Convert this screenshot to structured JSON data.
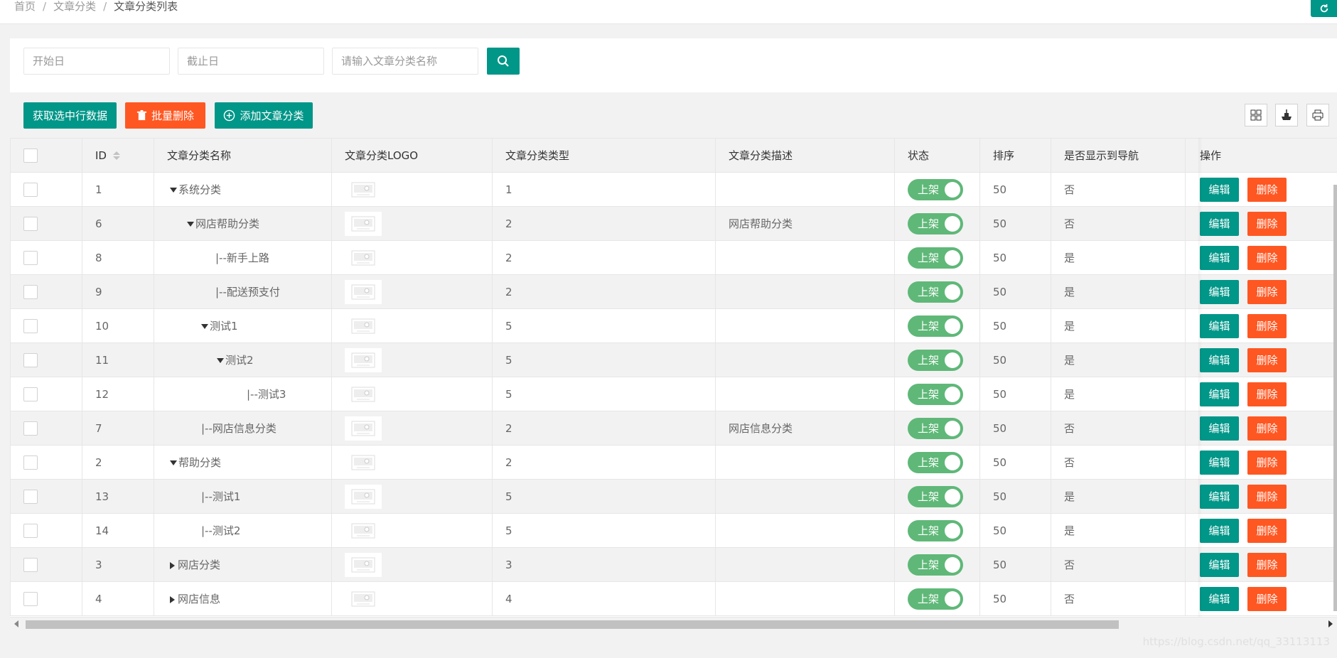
{
  "breadcrumb": [
    "首页",
    "文章分类",
    "文章分类列表"
  ],
  "search": {
    "start_placeholder": "开始日",
    "end_placeholder": "截止日",
    "name_placeholder": "请输入文章分类名称"
  },
  "toolbar": {
    "get_selected": "获取选中行数据",
    "batch_delete": "批量删除",
    "add_category": "添加文章分类"
  },
  "table": {
    "headers": {
      "id": "ID",
      "name": "文章分类名称",
      "logo": "文章分类LOGO",
      "type": "文章分类类型",
      "desc": "文章分类描述",
      "status": "状态",
      "sort": "排序",
      "nav": "是否显示到导航",
      "ops": "操作"
    },
    "status_label": "上架",
    "edit_label": "编辑",
    "delete_label": "删除",
    "rows": [
      {
        "id": "1",
        "name": "系统分类",
        "prefix": "down",
        "level": 0,
        "type": "1",
        "desc": "",
        "sort": "50",
        "nav": "否"
      },
      {
        "id": "6",
        "name": "网店帮助分类",
        "prefix": "down",
        "level": 1,
        "type": "2",
        "desc": "网店帮助分类",
        "sort": "50",
        "nav": "否"
      },
      {
        "id": "8",
        "name": "|--新手上路",
        "prefix": "none",
        "level": 2,
        "type": "2",
        "desc": "",
        "sort": "50",
        "nav": "是"
      },
      {
        "id": "9",
        "name": "|--配送预支付",
        "prefix": "none",
        "level": 2,
        "type": "2",
        "desc": "",
        "sort": "50",
        "nav": "是"
      },
      {
        "id": "10",
        "name": "测试1",
        "prefix": "down",
        "level": 2,
        "type": "5",
        "desc": "",
        "sort": "50",
        "nav": "是"
      },
      {
        "id": "11",
        "name": "测试2",
        "prefix": "down",
        "level": 3,
        "type": "5",
        "desc": "",
        "sort": "50",
        "nav": "是"
      },
      {
        "id": "12",
        "name": "|--测试3",
        "prefix": "none",
        "level": 4,
        "type": "5",
        "desc": "",
        "sort": "50",
        "nav": "是"
      },
      {
        "id": "7",
        "name": "|--网店信息分类",
        "prefix": "none",
        "level": 1,
        "type": "2",
        "desc": "网店信息分类",
        "sort": "50",
        "nav": "否"
      },
      {
        "id": "2",
        "name": "帮助分类",
        "prefix": "down",
        "level": 0,
        "type": "2",
        "desc": "",
        "sort": "50",
        "nav": "否"
      },
      {
        "id": "13",
        "name": "|--测试1",
        "prefix": "none",
        "level": 1,
        "type": "5",
        "desc": "",
        "sort": "50",
        "nav": "是"
      },
      {
        "id": "14",
        "name": "|--测试2",
        "prefix": "none",
        "level": 1,
        "type": "5",
        "desc": "",
        "sort": "50",
        "nav": "是"
      },
      {
        "id": "3",
        "name": "网店分类",
        "prefix": "right",
        "level": 0,
        "type": "3",
        "desc": "",
        "sort": "50",
        "nav": "否"
      },
      {
        "id": "4",
        "name": "网店信息",
        "prefix": "right",
        "level": 0,
        "type": "4",
        "desc": "",
        "sort": "50",
        "nav": "否"
      }
    ]
  },
  "watermark": "https://blog.csdn.net/qq_33113113",
  "colors": {
    "primary": "#009688",
    "danger": "#FF5722",
    "switch_on": "#5FB878"
  }
}
